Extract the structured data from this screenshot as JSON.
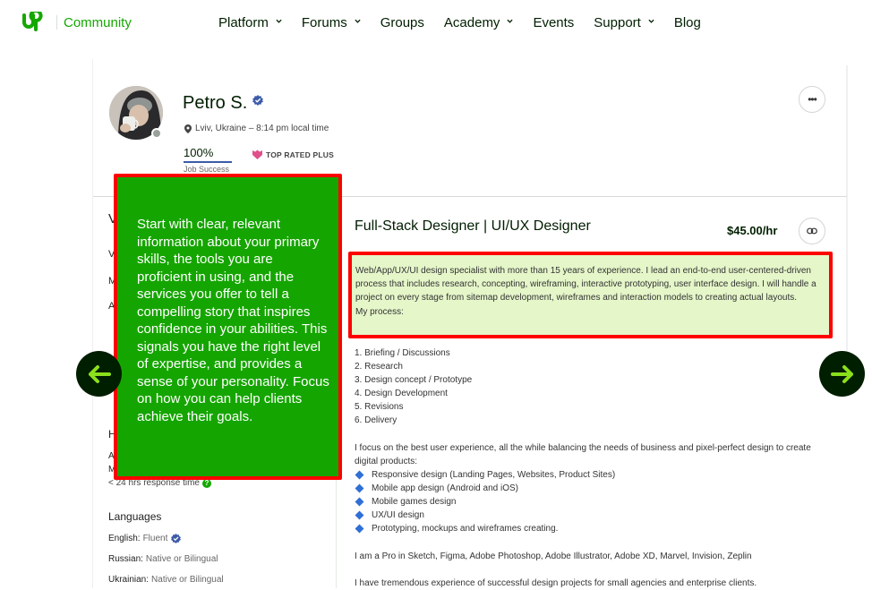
{
  "brand": {
    "logo": "upwork-logo",
    "community_label": "Community",
    "accent_color": "#14a800"
  },
  "nav": {
    "items": [
      {
        "label": "Platform",
        "dropdown": true
      },
      {
        "label": "Forums",
        "dropdown": true
      },
      {
        "label": "Groups",
        "dropdown": false
      },
      {
        "label": "Academy",
        "dropdown": true
      },
      {
        "label": "Events",
        "dropdown": false
      },
      {
        "label": "Support",
        "dropdown": true
      },
      {
        "label": "Blog",
        "dropdown": false
      }
    ]
  },
  "profile": {
    "name": "Petro S.",
    "location": "Lviv, Ukraine – 8:14 pm local time",
    "job_success_value": "100%",
    "job_success_label": "Job Success",
    "job_success_percent": 100,
    "badge": "TOP RATED PLUS",
    "more_label": "•••"
  },
  "left_column": {
    "partial_letters": [
      "V",
      "V",
      "M",
      "A",
      "H",
      "A",
      "M"
    ],
    "response_time": "< 24 hrs response time",
    "languages_title": "Languages",
    "languages": [
      {
        "name": "English:",
        "level": "Fluent",
        "verified": true
      },
      {
        "name": "Russian:",
        "level": "Native or Bilingual",
        "verified": false
      },
      {
        "name": "Ukrainian:",
        "level": "Native or Bilingual",
        "verified": false
      }
    ]
  },
  "main": {
    "title": "Full-Stack Designer | UI/UX Designer",
    "rate": "$45.00/hr",
    "overview_highlighted": "Web/App/UX/UI design specialist with more than 15 years of experience. I lead an end-to-end user-centered-driven process that includes research, concepting, wireframing, interactive prototyping, user interface design. I will handle a project on every stage from sitemap development, wireframes and interaction models to creating actual layouts.",
    "process_label": "My process:",
    "process_steps": [
      "1. Briefing / Discussions",
      "2. Research",
      "3. Design concept / Prototype",
      "4. Design Development",
      "5. Revisions",
      "6. Delivery"
    ],
    "focus_text": "I focus on the best user experience, all the while balancing the needs of business and pixel-perfect design to create digital products:",
    "services": [
      "Responsive design (Landing Pages, Websites, Product Sites)",
      "Mobile app design (Android and iOS)",
      "Mobile games design",
      "UX/UI design",
      "Prototyping, mockups and wireframes creating."
    ],
    "tools_text": "I am a Pro in Sketch, Figma, Adobe Photoshop, Adobe Illustrator, Adobe XD, Marvel, Invision, Zeplin",
    "experience_text": "I have tremendous experience of successful design projects for small agencies and enterprise clients."
  },
  "tooltip": {
    "text": "Start with clear, relevant information about your primary skills, the tools you are proficient in using, and the services you offer to tell a compelling story that inspires confidence in your abilities. This signals you have the right level of expertise, and provides a sense of your personality. Focus on how you can help clients achieve their goals."
  },
  "colors": {
    "tooltip_bg": "#15a500",
    "annotation_border": "#ff0000",
    "highlight_bg": "#e5f6c9",
    "arrow_bg": "#001e00",
    "arrow_fg": "#8be01c"
  }
}
